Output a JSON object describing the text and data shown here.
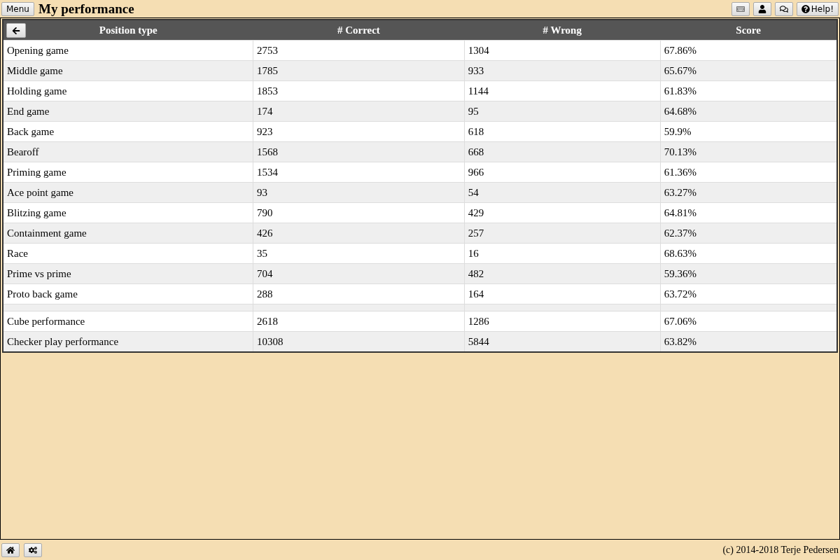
{
  "header": {
    "menu_button": "Menu",
    "title": "My performance",
    "help_button": "Help!"
  },
  "table": {
    "columns": [
      "Position type",
      "# Correct",
      "# Wrong",
      "Score"
    ],
    "rows": [
      {
        "kind": "data",
        "cells": [
          "Opening game",
          "2753",
          "1304",
          "67.86%"
        ]
      },
      {
        "kind": "data",
        "cells": [
          "Middle game",
          "1785",
          "933",
          "65.67%"
        ]
      },
      {
        "kind": "data",
        "cells": [
          "Holding game",
          "1853",
          "1144",
          "61.83%"
        ]
      },
      {
        "kind": "data",
        "cells": [
          "End game",
          "174",
          "95",
          "64.68%"
        ]
      },
      {
        "kind": "data",
        "cells": [
          "Back game",
          "923",
          "618",
          "59.9%"
        ]
      },
      {
        "kind": "data",
        "cells": [
          "Bearoff",
          "1568",
          "668",
          "70.13%"
        ]
      },
      {
        "kind": "data",
        "cells": [
          "Priming game",
          "1534",
          "966",
          "61.36%"
        ]
      },
      {
        "kind": "data",
        "cells": [
          "Ace point game",
          "93",
          "54",
          "63.27%"
        ]
      },
      {
        "kind": "data",
        "cells": [
          "Blitzing game",
          "790",
          "429",
          "64.81%"
        ]
      },
      {
        "kind": "data",
        "cells": [
          "Containment game",
          "426",
          "257",
          "62.37%"
        ]
      },
      {
        "kind": "data",
        "cells": [
          "Race",
          "35",
          "16",
          "68.63%"
        ]
      },
      {
        "kind": "data",
        "cells": [
          "Prime vs prime",
          "704",
          "482",
          "59.36%"
        ]
      },
      {
        "kind": "data",
        "cells": [
          "Proto back game",
          "288",
          "164",
          "63.72%"
        ]
      },
      {
        "kind": "spacer"
      },
      {
        "kind": "data",
        "cells": [
          "Cube performance",
          "2618",
          "1286",
          "67.06%"
        ]
      },
      {
        "kind": "data",
        "cells": [
          "Checker play performance",
          "10308",
          "5844",
          "63.82%"
        ]
      }
    ]
  },
  "footer": {
    "copyright": "(c) 2014-2018 Terje Pedersen"
  }
}
